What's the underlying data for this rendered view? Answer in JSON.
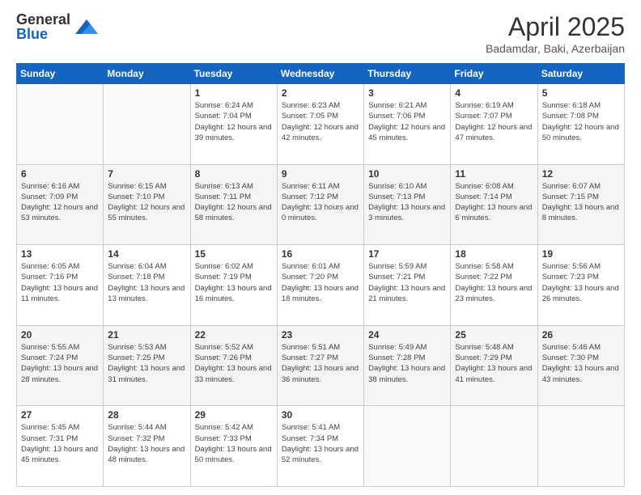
{
  "logo": {
    "general": "General",
    "blue": "Blue"
  },
  "header": {
    "title": "April 2025",
    "subtitle": "Badamdar, Baki, Azerbaijan"
  },
  "weekdays": [
    "Sunday",
    "Monday",
    "Tuesday",
    "Wednesday",
    "Thursday",
    "Friday",
    "Saturday"
  ],
  "rows": [
    [
      {
        "day": "",
        "info": ""
      },
      {
        "day": "",
        "info": ""
      },
      {
        "day": "1",
        "info": "Sunrise: 6:24 AM\nSunset: 7:04 PM\nDaylight: 12 hours and 39 minutes."
      },
      {
        "day": "2",
        "info": "Sunrise: 6:23 AM\nSunset: 7:05 PM\nDaylight: 12 hours and 42 minutes."
      },
      {
        "day": "3",
        "info": "Sunrise: 6:21 AM\nSunset: 7:06 PM\nDaylight: 12 hours and 45 minutes."
      },
      {
        "day": "4",
        "info": "Sunrise: 6:19 AM\nSunset: 7:07 PM\nDaylight: 12 hours and 47 minutes."
      },
      {
        "day": "5",
        "info": "Sunrise: 6:18 AM\nSunset: 7:08 PM\nDaylight: 12 hours and 50 minutes."
      }
    ],
    [
      {
        "day": "6",
        "info": "Sunrise: 6:16 AM\nSunset: 7:09 PM\nDaylight: 12 hours and 53 minutes."
      },
      {
        "day": "7",
        "info": "Sunrise: 6:15 AM\nSunset: 7:10 PM\nDaylight: 12 hours and 55 minutes."
      },
      {
        "day": "8",
        "info": "Sunrise: 6:13 AM\nSunset: 7:11 PM\nDaylight: 12 hours and 58 minutes."
      },
      {
        "day": "9",
        "info": "Sunrise: 6:11 AM\nSunset: 7:12 PM\nDaylight: 13 hours and 0 minutes."
      },
      {
        "day": "10",
        "info": "Sunrise: 6:10 AM\nSunset: 7:13 PM\nDaylight: 13 hours and 3 minutes."
      },
      {
        "day": "11",
        "info": "Sunrise: 6:08 AM\nSunset: 7:14 PM\nDaylight: 13 hours and 6 minutes."
      },
      {
        "day": "12",
        "info": "Sunrise: 6:07 AM\nSunset: 7:15 PM\nDaylight: 13 hours and 8 minutes."
      }
    ],
    [
      {
        "day": "13",
        "info": "Sunrise: 6:05 AM\nSunset: 7:16 PM\nDaylight: 13 hours and 11 minutes."
      },
      {
        "day": "14",
        "info": "Sunrise: 6:04 AM\nSunset: 7:18 PM\nDaylight: 13 hours and 13 minutes."
      },
      {
        "day": "15",
        "info": "Sunrise: 6:02 AM\nSunset: 7:19 PM\nDaylight: 13 hours and 16 minutes."
      },
      {
        "day": "16",
        "info": "Sunrise: 6:01 AM\nSunset: 7:20 PM\nDaylight: 13 hours and 18 minutes."
      },
      {
        "day": "17",
        "info": "Sunrise: 5:59 AM\nSunset: 7:21 PM\nDaylight: 13 hours and 21 minutes."
      },
      {
        "day": "18",
        "info": "Sunrise: 5:58 AM\nSunset: 7:22 PM\nDaylight: 13 hours and 23 minutes."
      },
      {
        "day": "19",
        "info": "Sunrise: 5:56 AM\nSunset: 7:23 PM\nDaylight: 13 hours and 26 minutes."
      }
    ],
    [
      {
        "day": "20",
        "info": "Sunrise: 5:55 AM\nSunset: 7:24 PM\nDaylight: 13 hours and 28 minutes."
      },
      {
        "day": "21",
        "info": "Sunrise: 5:53 AM\nSunset: 7:25 PM\nDaylight: 13 hours and 31 minutes."
      },
      {
        "day": "22",
        "info": "Sunrise: 5:52 AM\nSunset: 7:26 PM\nDaylight: 13 hours and 33 minutes."
      },
      {
        "day": "23",
        "info": "Sunrise: 5:51 AM\nSunset: 7:27 PM\nDaylight: 13 hours and 36 minutes."
      },
      {
        "day": "24",
        "info": "Sunrise: 5:49 AM\nSunset: 7:28 PM\nDaylight: 13 hours and 38 minutes."
      },
      {
        "day": "25",
        "info": "Sunrise: 5:48 AM\nSunset: 7:29 PM\nDaylight: 13 hours and 41 minutes."
      },
      {
        "day": "26",
        "info": "Sunrise: 5:46 AM\nSunset: 7:30 PM\nDaylight: 13 hours and 43 minutes."
      }
    ],
    [
      {
        "day": "27",
        "info": "Sunrise: 5:45 AM\nSunset: 7:31 PM\nDaylight: 13 hours and 45 minutes."
      },
      {
        "day": "28",
        "info": "Sunrise: 5:44 AM\nSunset: 7:32 PM\nDaylight: 13 hours and 48 minutes."
      },
      {
        "day": "29",
        "info": "Sunrise: 5:42 AM\nSunset: 7:33 PM\nDaylight: 13 hours and 50 minutes."
      },
      {
        "day": "30",
        "info": "Sunrise: 5:41 AM\nSunset: 7:34 PM\nDaylight: 13 hours and 52 minutes."
      },
      {
        "day": "",
        "info": ""
      },
      {
        "day": "",
        "info": ""
      },
      {
        "day": "",
        "info": ""
      }
    ]
  ]
}
